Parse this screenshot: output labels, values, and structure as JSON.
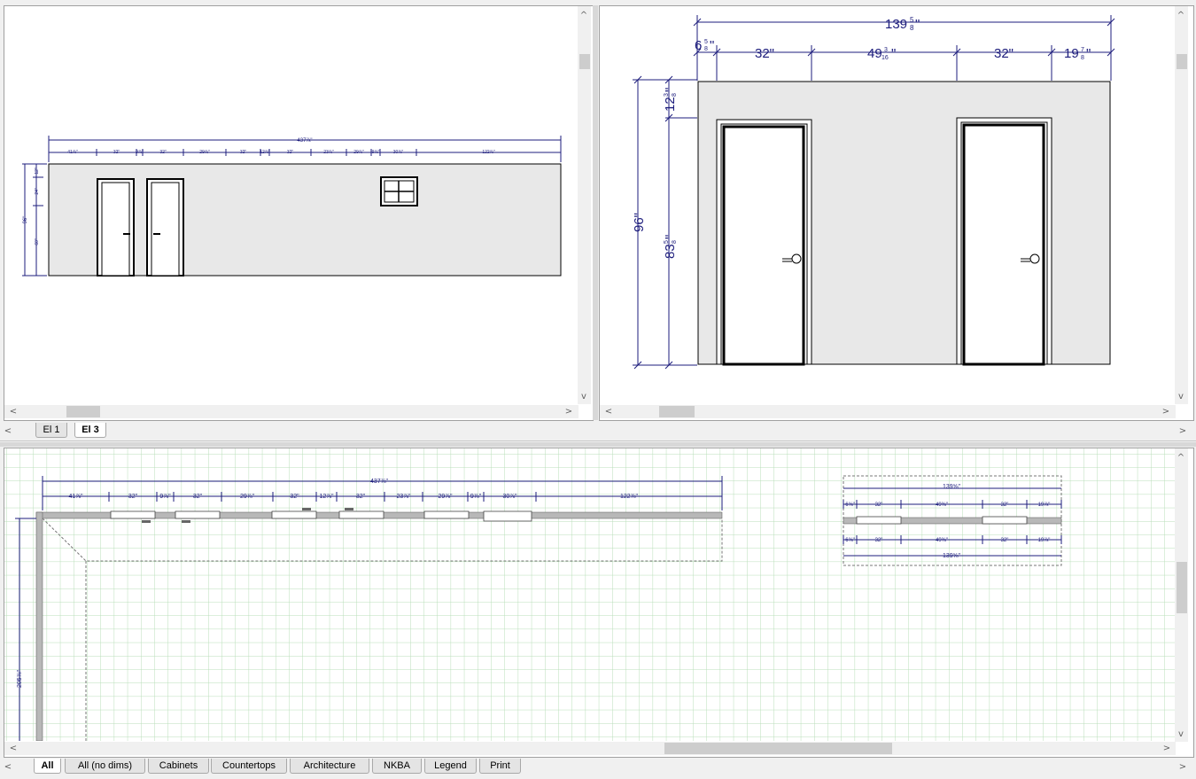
{
  "top_tabs": [
    {
      "label": "El 1",
      "active": false
    },
    {
      "label": "El 3",
      "active": true
    }
  ],
  "bottom_tabs": [
    {
      "label": "All",
      "active": true
    },
    {
      "label": "All (no dims)",
      "active": false
    },
    {
      "label": "Cabinets",
      "active": false
    },
    {
      "label": "Countertops",
      "active": false
    },
    {
      "label": "Architecture",
      "active": false
    },
    {
      "label": "NKBA",
      "active": false
    },
    {
      "label": "Legend",
      "active": false
    },
    {
      "label": "Print",
      "active": false
    }
  ],
  "elevation1": {
    "overall": "437⅞\"",
    "segments": [
      "41⅞\"",
      "32\"",
      "9⅞\"",
      "32\"",
      "29⅞\"",
      "32\"",
      "12⅞\"",
      "32\"",
      "23⅞\"",
      "29⅞\"",
      "9⅞\"",
      "30⅞\"",
      "122⅞\""
    ],
    "height_total": "96\"",
    "height_parts": [
      "12\"",
      "24\"",
      "60\""
    ]
  },
  "elevation3": {
    "overall_whole": "139",
    "overall_num": "5",
    "overall_den": "8",
    "segments": [
      {
        "whole": "6",
        "num": "5",
        "den": "8"
      },
      {
        "whole": "32\"",
        "num": "",
        "den": ""
      },
      {
        "whole": "49",
        "num": "3",
        "den": "16"
      },
      {
        "whole": "32\"",
        "num": "",
        "den": ""
      },
      {
        "whole": "19",
        "num": "7",
        "den": "8"
      }
    ],
    "height_total": "96\"",
    "height_upper_whole": "12",
    "height_upper_num": "3",
    "height_upper_den": "8",
    "height_lower_whole": "83",
    "height_lower_num": "5",
    "height_lower_den": "8"
  },
  "plan": {
    "top_overall": "437⅞\"",
    "top_segments": [
      "41⅞\"",
      "32\"",
      "9⅞\"",
      "32\"",
      "29⅞\"",
      "32\"",
      "12⅞\"",
      "32\"",
      "23⅞\"",
      "29⅞\"",
      "9⅞\"",
      "30⅞\"",
      "122⅞\""
    ],
    "left_overall": "205⅞\"",
    "small_overall": "139⅝\"",
    "small_segments": [
      "6⅝\"",
      "32\"",
      "49⅜\"",
      "32\"",
      "19⅞\""
    ],
    "small_overall_bottom": "139⅝\""
  }
}
